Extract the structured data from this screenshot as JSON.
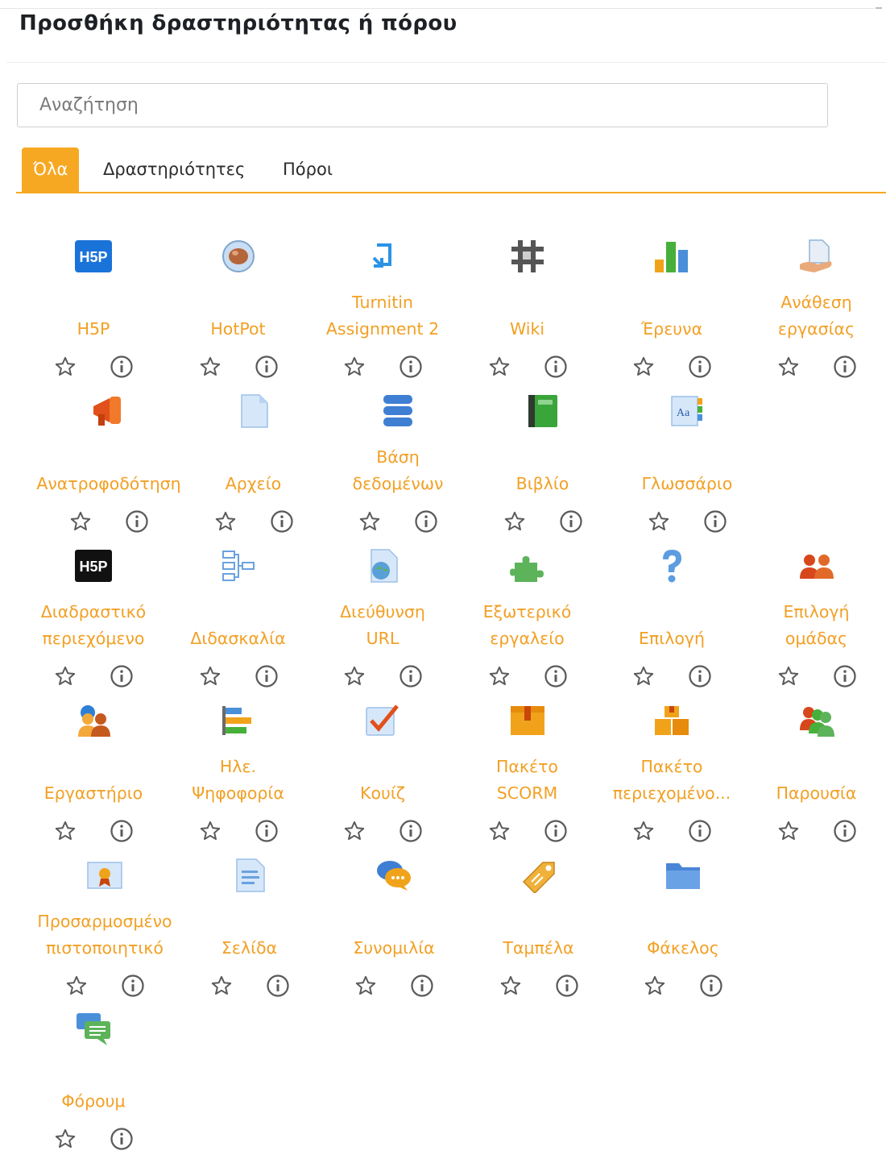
{
  "dialog": {
    "title": "Προσθήκη δραστηριότητας ή πόρου",
    "search_placeholder": "Αναζήτηση"
  },
  "tabs": [
    {
      "label": "Όλα",
      "active": true
    },
    {
      "label": "Δραστηριότητες",
      "active": false
    },
    {
      "label": "Πόροι",
      "active": false
    }
  ],
  "colors": {
    "accent": "#f7a823",
    "label": "#f2a024"
  },
  "modules": [
    {
      "label": "H5P",
      "icon": "h5p-icon"
    },
    {
      "label": "HotPot",
      "icon": "hotpot-icon"
    },
    {
      "label": "Turnitin\nAssignment 2",
      "icon": "turnitin-icon"
    },
    {
      "label": "Wiki",
      "icon": "wiki-icon"
    },
    {
      "label": "Έρευνα",
      "icon": "survey-icon"
    },
    {
      "label": "Ανάθεση\nεργασίας",
      "icon": "assignment-icon"
    },
    {
      "label": "Ανατροφοδότηση",
      "icon": "feedback-icon"
    },
    {
      "label": "Αρχείο",
      "icon": "file-icon"
    },
    {
      "label": "Βάση\nδεδομένων",
      "icon": "database-icon"
    },
    {
      "label": "Βιβλίο",
      "icon": "book-icon"
    },
    {
      "label": "Γλωσσάριο",
      "icon": "glossary-icon"
    },
    {
      "label": "Διαδραστικό\nπεριεχόμενο",
      "icon": "interactive-content-icon"
    },
    {
      "label": "Διδασκαλία",
      "icon": "lesson-icon"
    },
    {
      "label": "Διεύθυνση\nURL",
      "icon": "url-icon"
    },
    {
      "label": "Εξωτερικό\nεργαλείο",
      "icon": "external-tool-icon"
    },
    {
      "label": "Επιλογή",
      "icon": "choice-icon"
    },
    {
      "label": "Επιλογή\nομάδας",
      "icon": "group-choice-icon"
    },
    {
      "label": "Εργαστήριο",
      "icon": "workshop-icon"
    },
    {
      "label": "Ηλε.\nΨηφοφορία",
      "icon": "evoting-icon"
    },
    {
      "label": "Κουίζ",
      "icon": "quiz-icon"
    },
    {
      "label": "Πακέτο\nSCORM",
      "icon": "scorm-icon"
    },
    {
      "label": "Πακέτο\nπεριεχομένο...",
      "icon": "content-package-icon"
    },
    {
      "label": "Παρουσία",
      "icon": "attendance-icon"
    },
    {
      "label": "Προσαρμοσμένο\nπιστοποιητικό",
      "icon": "certificate-icon"
    },
    {
      "label": "Σελίδα",
      "icon": "page-icon"
    },
    {
      "label": "Συνομιλία",
      "icon": "chat-icon"
    },
    {
      "label": "Ταμπέλα",
      "icon": "label-icon"
    },
    {
      "label": "Φάκελος",
      "icon": "folder-icon"
    },
    {
      "label": "Φόρουμ",
      "icon": "forum-icon"
    }
  ]
}
